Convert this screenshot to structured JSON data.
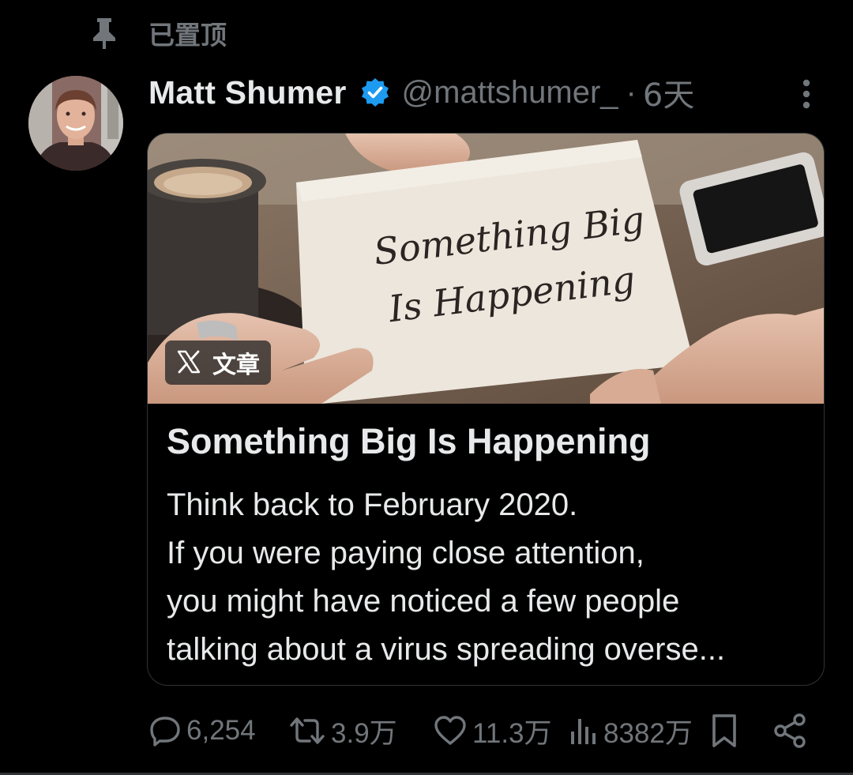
{
  "pinned": {
    "label": "已置顶"
  },
  "author": {
    "name": "Matt Shumer",
    "handle": "@mattshumer_",
    "separator": "·",
    "time": "6天"
  },
  "card": {
    "badge": "文章",
    "image_text_line1": "Something Big",
    "image_text_line2": "Is Happening",
    "title": "Something Big Is Happening",
    "excerpt": [
      "Think back to February 2020.",
      "If you were paying close attention,",
      "you might have noticed a few people",
      "talking about a virus spreading overse..."
    ]
  },
  "actions": {
    "replies": "6,254",
    "reposts": "3.9万",
    "likes": "11.3万",
    "views": "8382万"
  },
  "icons": {
    "pin": "pin-icon",
    "verified": "verified-badge-icon",
    "more": "more-vertical-icon",
    "x_logo": "x-logo-icon",
    "reply": "speech-bubble-icon",
    "repost": "repost-arrows-icon",
    "like": "heart-icon",
    "views": "bar-chart-icon",
    "bookmark": "bookmark-icon",
    "share": "share-nodes-icon"
  },
  "colors": {
    "background": "#000000",
    "text_primary": "#e7e9ea",
    "text_secondary": "#71767b",
    "verified_blue": "#1d9bf0",
    "border": "#2f3336"
  }
}
